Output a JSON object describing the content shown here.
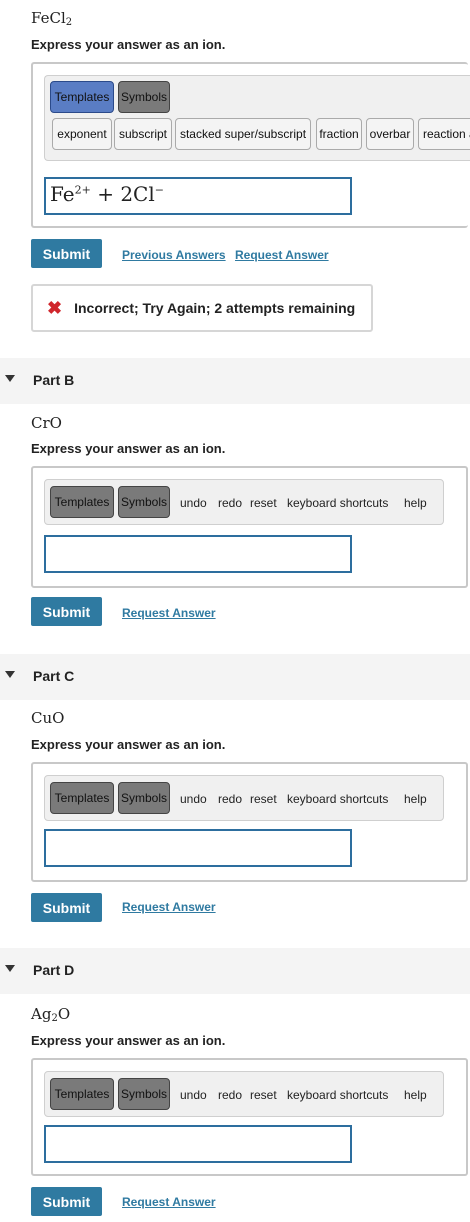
{
  "partA": {
    "formula_main": "FeCl",
    "formula_sub": "2",
    "instruction": "Express your answer as an ion.",
    "toolbar": {
      "templates": "Templates",
      "symbols": "Symbols",
      "tools": [
        "exponent",
        "subscript",
        "stacked super/subscript",
        "fraction",
        "overbar",
        "reaction a"
      ]
    },
    "answer": {
      "fe": "Fe",
      "fe_charge": "2+",
      "plus": " + 2Cl",
      "cl_charge": "−"
    },
    "submit": "Submit",
    "previous_answers": "Previous Answers",
    "request_answer": "Request Answer",
    "feedback": "Incorrect; Try Again; 2 attempts remaining"
  },
  "parts": [
    {
      "title": "Part B",
      "formula_main": "CrO",
      "formula_sub": ""
    },
    {
      "title": "Part C",
      "formula_main": "CuO",
      "formula_sub": ""
    },
    {
      "title": "Part D",
      "formula_main": "Ag",
      "formula_sub": "2",
      "formula_tail": "O"
    }
  ],
  "common": {
    "instruction": "Express your answer as an ion.",
    "templates": "Templates",
    "symbols": "Symbols",
    "undo": "undo",
    "redo": "redo",
    "reset": "reset",
    "shortcuts": "keyboard shortcuts",
    "help": "help",
    "submit": "Submit",
    "request_answer": "Request Answer"
  }
}
